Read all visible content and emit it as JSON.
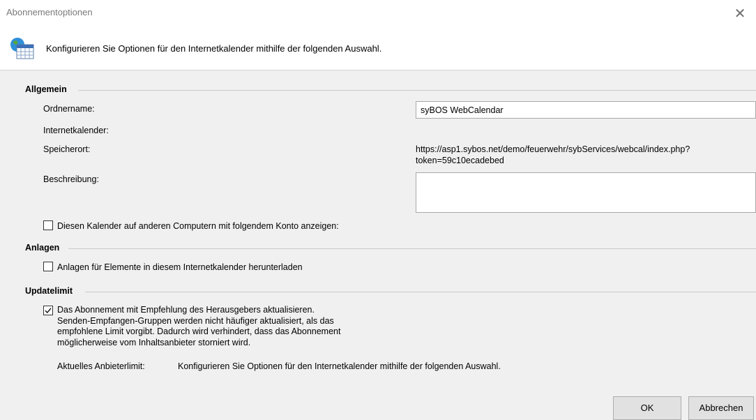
{
  "window": {
    "title": "Abonnementoptionen",
    "header_text": "Konfigurieren Sie Optionen für den Internetkalender mithilfe der folgenden Auswahl."
  },
  "general": {
    "group_title": "Allgemein",
    "folder_name_label": "Ordnername:",
    "folder_name_value": "syBOS WebCalendar",
    "calendar_label": "Internetkalender:",
    "location_label": "Speicherort:",
    "location_line1": "https://asp1.sybos.net/demo/feuerwehr/sybServices/webcal/index.php?",
    "location_line2": "token=59c10ecadebed",
    "description_label": "Beschreibung:",
    "description_value": "",
    "show_other_computers_label": "Diesen Kalender auf anderen Computern mit folgendem Konto anzeigen:",
    "show_other_computers_checked": false
  },
  "attachments": {
    "group_title": "Anlagen",
    "download_label": "Anlagen für Elemente in diesem Internetkalender herunterladen",
    "download_checked": false
  },
  "update_limit": {
    "group_title": "Updatelimit",
    "line1": "Das Abonnement mit Empfehlung des Herausgebers aktualisieren.",
    "line2": "Senden-Empfangen-Gruppen werden nicht häufiger aktualisiert, als das",
    "line3": "empfohlene Limit vorgibt. Dadurch wird verhindert, dass das Abonnement",
    "line4": "möglicherweise vom Inhaltsanbieter storniert wird.",
    "checked": true,
    "provider_limit_label": "Aktuelles Anbieterlimit:",
    "provider_limit_value": "Konfigurieren Sie Optionen für den Internetkalender mithilfe der folgenden Auswahl."
  },
  "buttons": {
    "ok": "OK",
    "cancel": "Abbrechen"
  },
  "icons": {
    "close": "close-icon",
    "header": "internet-calendar-icon",
    "checkmark": "checkmark-icon"
  },
  "colors": {
    "content_background": "#f0f0f0",
    "button_background": "#e1e1e1",
    "title_gray": "#7a7a7a"
  }
}
